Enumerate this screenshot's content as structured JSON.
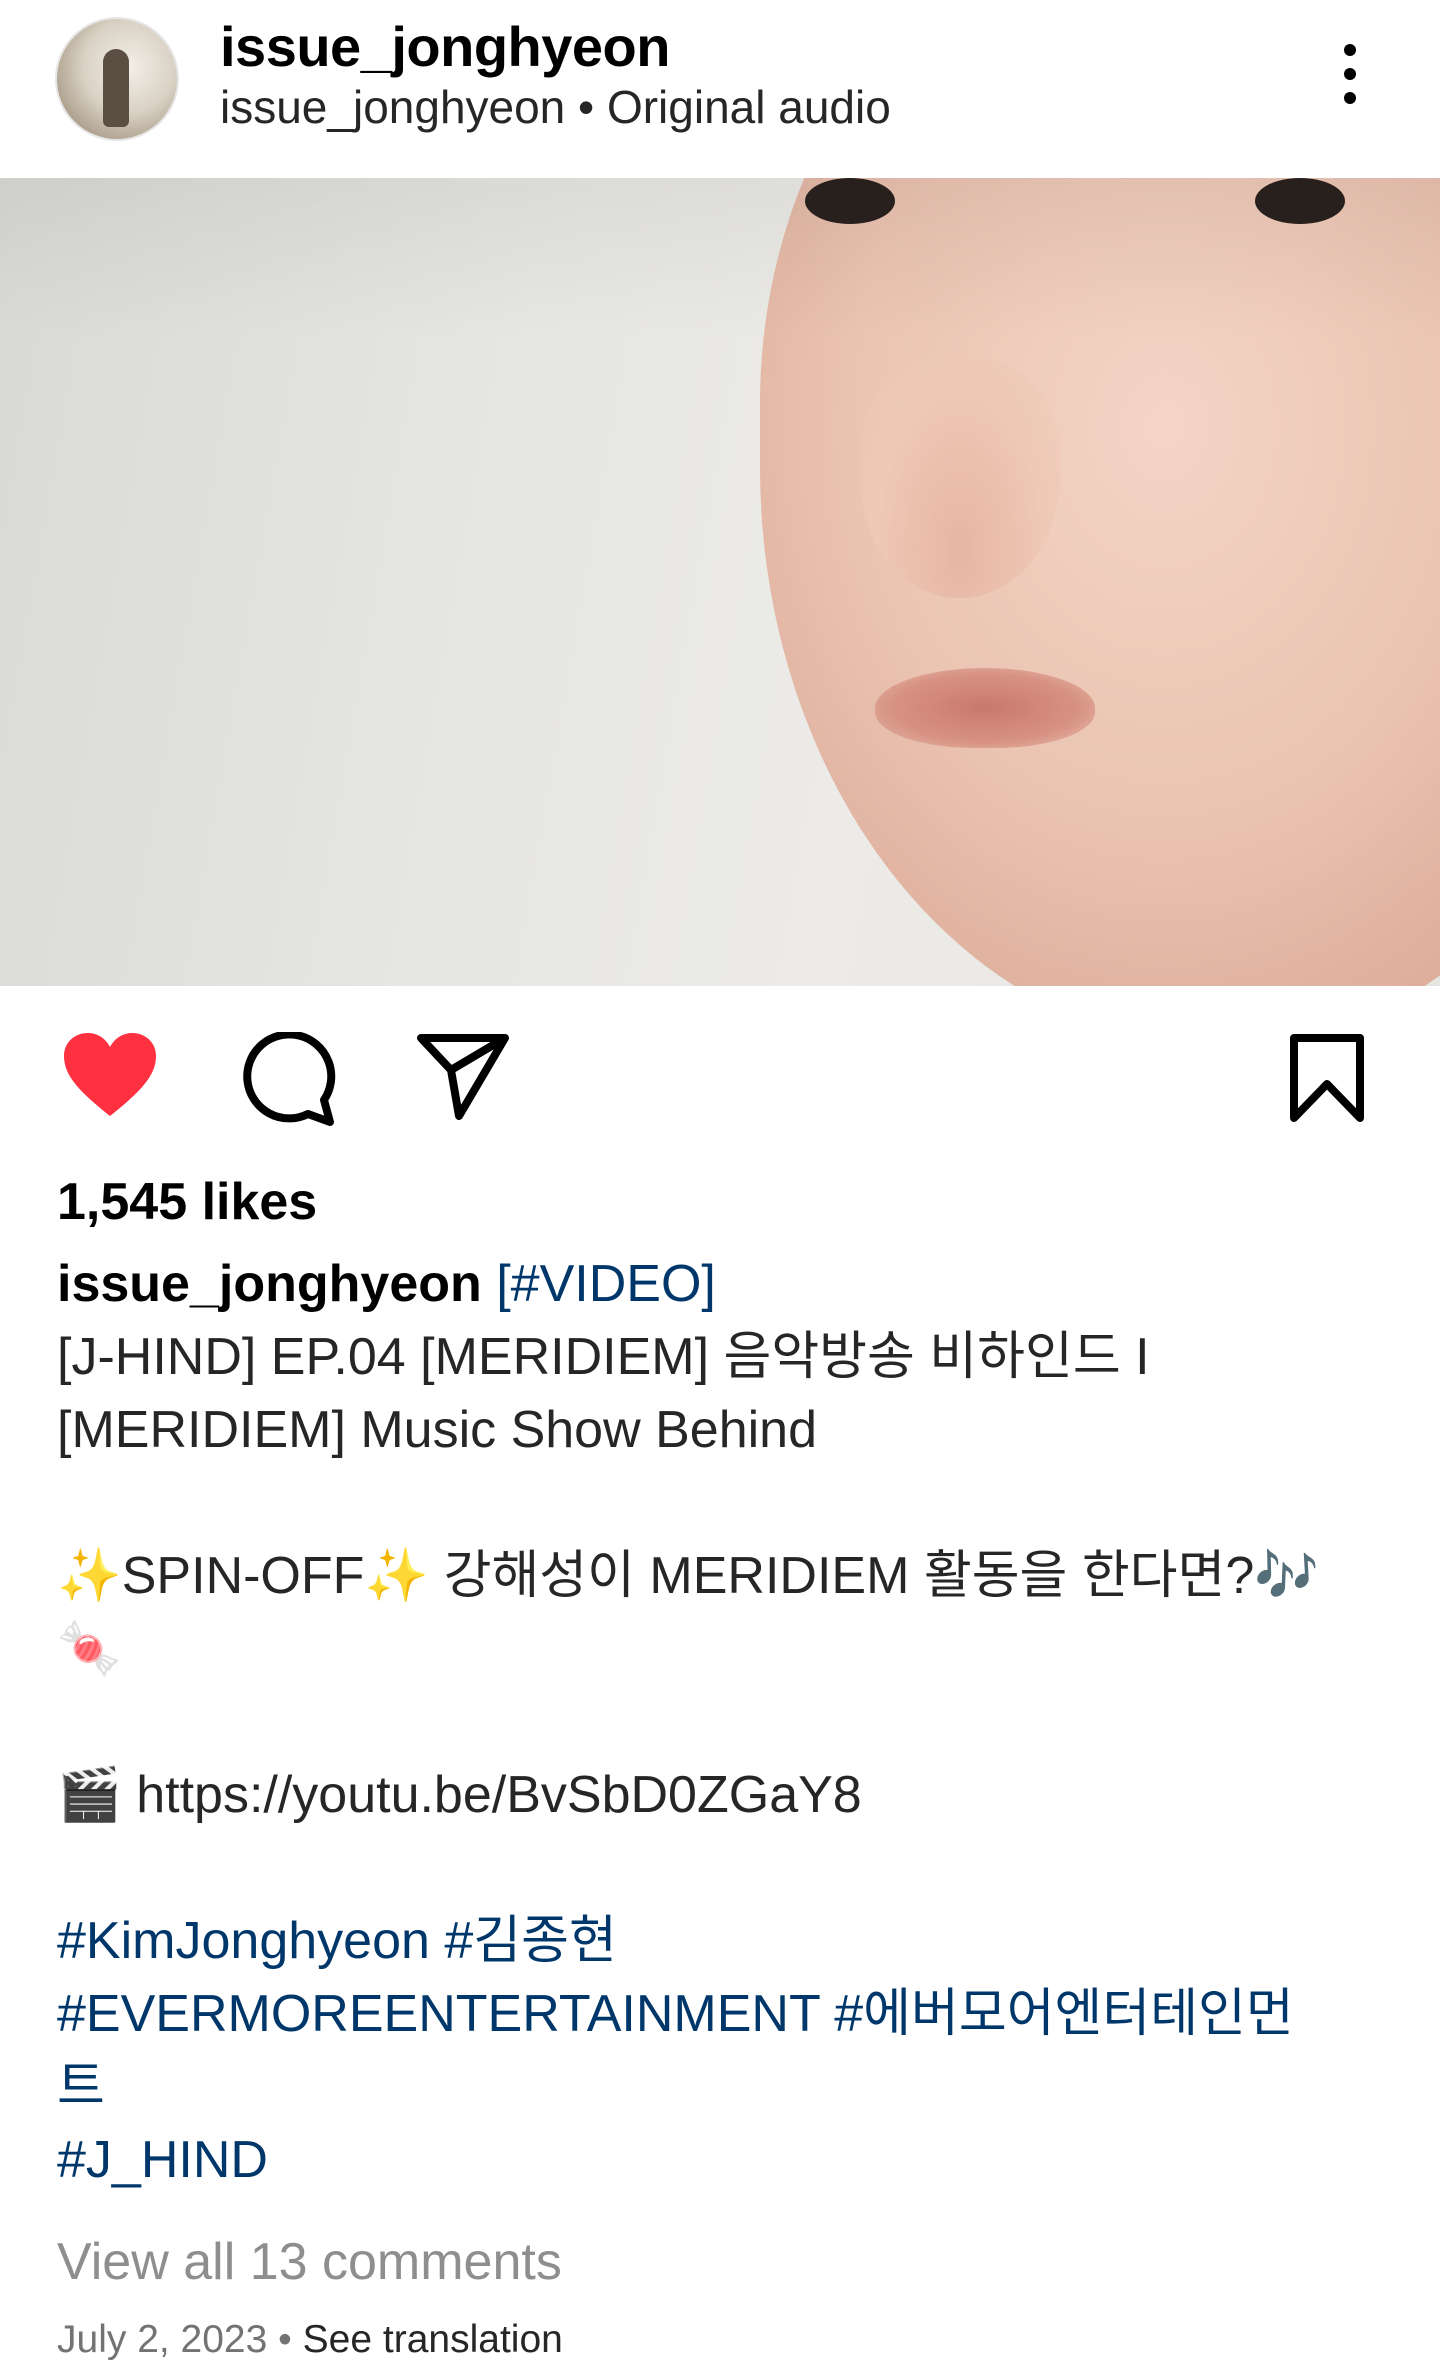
{
  "header": {
    "username": "issue_jonghyeon",
    "audio_owner": "issue_jonghyeon",
    "separator": " • ",
    "audio_label": "Original audio"
  },
  "post": {
    "likes_text": "1,545 likes",
    "caption": {
      "author": "issue_jonghyeon",
      "tag_video": "[#VIDEO]",
      "line1": "[J-HIND] EP.04 [MERIDIEM] 음악방송 비하인드 I",
      "line2": "[MERIDIEM] Music Show Behind",
      "sparkle": "✨",
      "spin_off": "SPIN-OFF",
      "korean_question": "강해성이 MERIDIEM 활동을 한다면?",
      "music_notes": "🎶",
      "candy": "🍬",
      "clapper": "🎬",
      "link": "https://youtu.be/BvSbD0ZGaY8",
      "hashtags_line1": [
        "#KimJonghyeon",
        "#김종현"
      ],
      "hashtags_line2": [
        "#EVERMOREENTERTAINMENT",
        "#에버모어엔터테인먼"
      ],
      "hashtags_line3": "트",
      "hashtags_line4": "#J_HIND"
    },
    "view_comments": "View all 13 comments",
    "date": "July 2, 2023",
    "dot": "•",
    "see_translation": "See translation"
  },
  "icons": {
    "like": "heart-filled-icon",
    "comment": "comment-icon",
    "share": "send-icon",
    "save": "bookmark-icon",
    "more": "more-vertical-icon"
  },
  "colors": {
    "like_red": "#ff3040",
    "hashtag_blue": "#00376b",
    "muted_gray": "#8e8e8e"
  }
}
